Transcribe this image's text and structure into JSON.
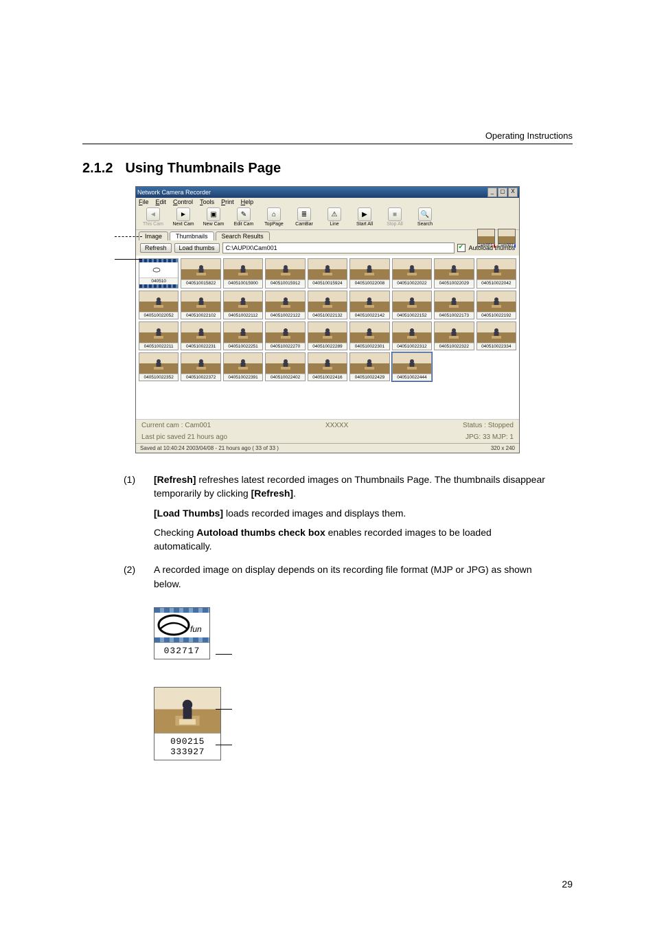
{
  "header": {
    "running": "Operating Instructions"
  },
  "section": {
    "num": "2.1.2",
    "title": "Using Thumbnails Page"
  },
  "screenshot": {
    "title": "Network Camera Recorder",
    "winbuttons": [
      "_",
      "▢",
      "X"
    ],
    "menus": [
      "File",
      "Edit",
      "Control",
      "Tools",
      "Print",
      "Help"
    ],
    "toolbar": [
      {
        "label": "This Cam",
        "icon": "◄",
        "disabled": true
      },
      {
        "label": "Next Cam",
        "icon": "►",
        "disabled": false
      },
      {
        "label": "New Cam",
        "icon": "▣",
        "disabled": false
      },
      {
        "label": "Edit Cam",
        "icon": "✎",
        "disabled": false
      },
      {
        "label": "TopPage",
        "icon": "⌂",
        "disabled": false
      },
      {
        "label": "CamBar",
        "icon": "≣",
        "disabled": false
      },
      {
        "label": "Line",
        "icon": "⚠",
        "disabled": false
      },
      {
        "label": "Start All",
        "icon": "▶",
        "disabled": false
      },
      {
        "label": "Stop All",
        "icon": "■",
        "disabled": true
      },
      {
        "label": "Search",
        "icon": "🔍",
        "disabled": false
      }
    ],
    "tabs": [
      "Image",
      "Thumbnails",
      "Search Results"
    ],
    "activeTab": 1,
    "subbar": {
      "refresh": "Refresh",
      "load": "Load thumbs",
      "path": "C:\\AUPIX\\Cam001",
      "autoload": "Autoload thumbs"
    },
    "thumbs": [
      {
        "cap": "040510",
        "film": true
      },
      {
        "cap": "040510015822"
      },
      {
        "cap": "040510015900"
      },
      {
        "cap": "040510015912"
      },
      {
        "cap": "040510015924"
      },
      {
        "cap": "040510022008"
      },
      {
        "cap": "040510022022"
      },
      {
        "cap": "040510022029"
      },
      {
        "cap": "040510022042"
      },
      {
        "cap": "040510022052"
      },
      {
        "cap": "040510022102"
      },
      {
        "cap": "040510022112"
      },
      {
        "cap": "040510022122"
      },
      {
        "cap": "040510022132"
      },
      {
        "cap": "040510022142"
      },
      {
        "cap": "040510022152"
      },
      {
        "cap": "040510022173"
      },
      {
        "cap": "040510022192"
      },
      {
        "cap": "040510022211"
      },
      {
        "cap": "040510022231"
      },
      {
        "cap": "040510022251"
      },
      {
        "cap": "040510022270"
      },
      {
        "cap": "040510022289"
      },
      {
        "cap": "040510022301"
      },
      {
        "cap": "040510022312"
      },
      {
        "cap": "040510022322"
      },
      {
        "cap": "040510022334"
      },
      {
        "cap": "040510022352"
      },
      {
        "cap": "040510022372"
      },
      {
        "cap": "040510022391"
      },
      {
        "cap": "040510022402"
      },
      {
        "cap": "040510022416"
      },
      {
        "cap": "040510022429"
      },
      {
        "cap": "040510022444",
        "selected": true
      }
    ],
    "minicams": [
      {
        "label": "Cam001",
        "dot": "red"
      },
      {
        "label": "Cam002",
        "dot": "blue"
      }
    ],
    "status": {
      "l1": "Current cam : Cam001",
      "c1": "XXXXX",
      "r1": "Status : Stopped",
      "l2": "Last pic saved 21 hours ago",
      "r2": "JPG: 33  MJP: 1",
      "bottomL": "Saved at 10:40:24 2003/04/08 - 21 hours ago ( 33 of 33 )",
      "bottomR": "320 x 240"
    }
  },
  "paragraphs": {
    "p1num": "(1)",
    "p1a_prefix": "",
    "p1a": "[Refresh] refreshes latest recorded images on Thumbnails Page. The thumbnails disappear temporarily by clicking [Refresh].",
    "p1b": "[Load Thumbs] loads recorded images and displays them.",
    "p1c": "Checking Autoload thumbs check box enables recorded images to be loaded automatically.",
    "p2num": "(2)",
    "p2": "A recorded image on display depends on its recording file format (MJP or JPG) as shown below."
  },
  "samples": {
    "film_caption": "032717",
    "photo_caption": "090215 333927"
  },
  "pagenum": "29"
}
